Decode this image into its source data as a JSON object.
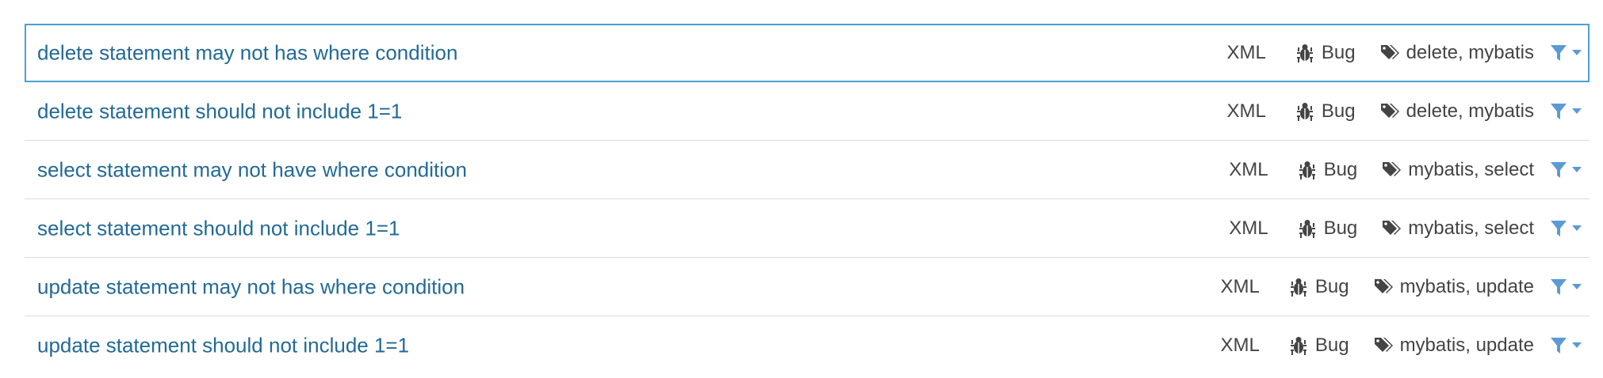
{
  "rules": [
    {
      "title": "delete statement may not has where condition",
      "language": "XML",
      "type": "Bug",
      "tags": "delete, mybatis",
      "selected": true
    },
    {
      "title": "delete statement should not include 1=1",
      "language": "XML",
      "type": "Bug",
      "tags": "delete, mybatis",
      "selected": false
    },
    {
      "title": "select statement may not have where condition",
      "language": "XML",
      "type": "Bug",
      "tags": "mybatis, select",
      "selected": false
    },
    {
      "title": "select statement should not include 1=1",
      "language": "XML",
      "type": "Bug",
      "tags": "mybatis, select",
      "selected": false
    },
    {
      "title": "update statement may not has where condition",
      "language": "XML",
      "type": "Bug",
      "tags": "mybatis, update",
      "selected": false
    },
    {
      "title": "update statement should not include 1=1",
      "language": "XML",
      "type": "Bug",
      "tags": "mybatis, update",
      "selected": false
    }
  ],
  "icons": {
    "type": "bug-icon",
    "tags": "tag-icon",
    "filter": "filter-icon",
    "dropdown": "caret-down-icon"
  },
  "colors": {
    "title": "#236a97",
    "meta_text": "#444444",
    "filter": "#5b9bd5",
    "selected_border": "#4b9fd5",
    "row_divider": "#dcdcdc"
  }
}
